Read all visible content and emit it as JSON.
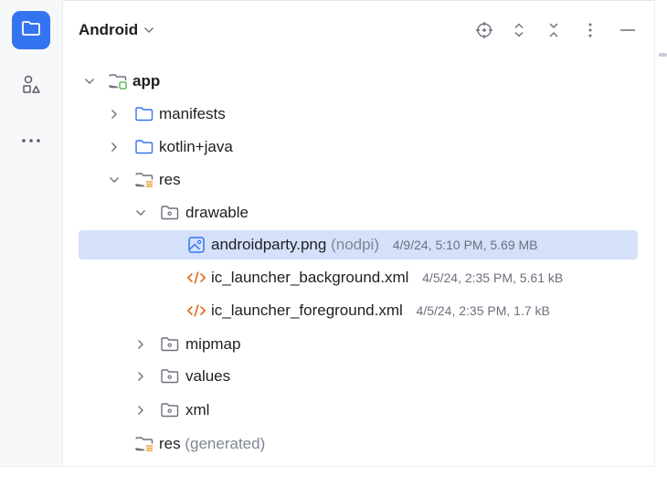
{
  "panel": {
    "title": "Android",
    "toolbar_icons": [
      "locate-icon",
      "expand-all-icon",
      "collapse-all-icon",
      "more-options-icon",
      "minimize-icon"
    ]
  },
  "strip": {
    "icons": [
      "project-folder-icon",
      "structure-icon",
      "more-tools-icon"
    ]
  },
  "tree": {
    "app": {
      "label": "app"
    },
    "manifests": {
      "label": "manifests"
    },
    "kotlin": {
      "label": "kotlin+java"
    },
    "res": {
      "label": "res"
    },
    "drawable": {
      "label": "drawable"
    },
    "androidparty": {
      "label": "androidparty.png",
      "qualifier": "(nodpi)",
      "meta": "4/9/24, 5:10 PM, 5.69 MB"
    },
    "launcher_bg": {
      "label": "ic_launcher_background.xml",
      "meta": "4/5/24, 2:35 PM, 5.61 kB"
    },
    "launcher_fg": {
      "label": "ic_launcher_foreground.xml",
      "meta": "4/5/24, 2:35 PM, 1.7 kB"
    },
    "mipmap": {
      "label": "mipmap"
    },
    "values": {
      "label": "values"
    },
    "xml": {
      "label": "xml"
    },
    "res_generated": {
      "label": "res",
      "suffix": "(generated)"
    }
  },
  "colors": {
    "accent": "#3574f0",
    "selection": "#d5e1fb",
    "xml_icon": "#e06c1b",
    "module_badge": "#5fb865",
    "res_badge": "#e8a33d"
  }
}
